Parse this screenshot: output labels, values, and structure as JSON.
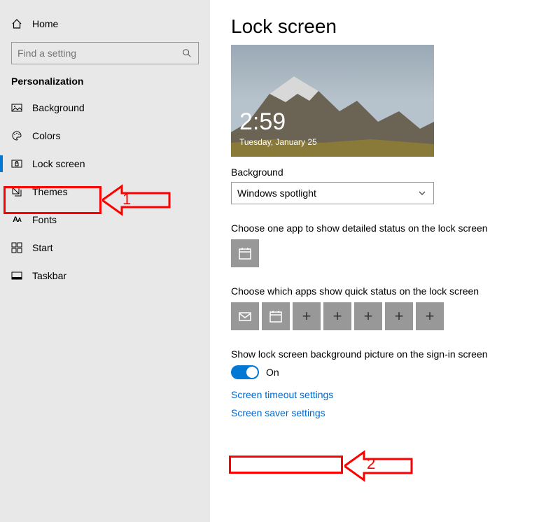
{
  "sidebar": {
    "home": "Home",
    "search_placeholder": "Find a setting",
    "section": "Personalization",
    "items": [
      {
        "label": "Background",
        "selected": false,
        "icon": "picture"
      },
      {
        "label": "Colors",
        "selected": false,
        "icon": "palette"
      },
      {
        "label": "Lock screen",
        "selected": true,
        "icon": "lockscreen"
      },
      {
        "label": "Themes",
        "selected": false,
        "icon": "themes"
      },
      {
        "label": "Fonts",
        "selected": false,
        "icon": "fonts"
      },
      {
        "label": "Start",
        "selected": false,
        "icon": "start"
      },
      {
        "label": "Taskbar",
        "selected": false,
        "icon": "taskbar"
      }
    ]
  },
  "main": {
    "title": "Lock screen",
    "preview": {
      "time": "2:59",
      "date": "Tuesday, January 25"
    },
    "background_label": "Background",
    "background_value": "Windows spotlight",
    "detailed_status_label": "Choose one app to show detailed status on the lock screen",
    "quick_status_label": "Choose which apps show quick status on the lock screen",
    "show_bg_label": "Show lock screen background picture on the sign-in screen",
    "toggle_state": "On",
    "link_timeout": "Screen timeout settings",
    "link_saver": "Screen saver settings"
  },
  "annotations": {
    "num1": "1",
    "num2": "2"
  }
}
